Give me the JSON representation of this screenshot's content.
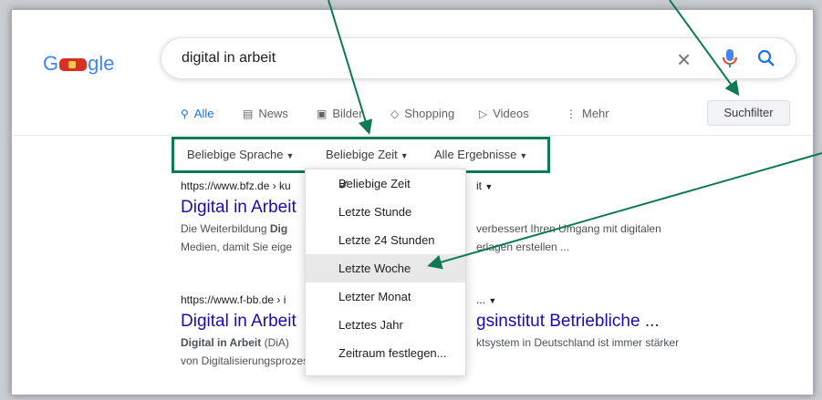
{
  "logo": {
    "text_left": "G",
    "text_right": "gle"
  },
  "search": {
    "query": "digital in arbeit",
    "clear_icon": "close-icon",
    "mic_icon": "microphone-icon",
    "search_icon": "search-icon"
  },
  "tabs": [
    {
      "label": "Alle",
      "icon": "search-icon"
    },
    {
      "label": "News",
      "icon": "news-icon"
    },
    {
      "label": "Bilder",
      "icon": "image-icon"
    },
    {
      "label": "Shopping",
      "icon": "tag-icon"
    },
    {
      "label": "Videos",
      "icon": "video-icon"
    },
    {
      "label": "Mehr",
      "icon": "more-icon"
    }
  ],
  "filter_button": "Suchfilter",
  "filterbar": {
    "language": "Beliebige Sprache",
    "time": "Beliebige Zeit",
    "results": "Alle Ergebnisse"
  },
  "dropdown": {
    "items": [
      "Beliebige Zeit",
      "Letzte Stunde",
      "Letzte 24 Stunden",
      "Letzte Woche",
      "Letzter Monat",
      "Letztes Jahr",
      "Zeitraum festlegen..."
    ],
    "selected": "Beliebige Zeit",
    "highlighted": "Letzte Woche"
  },
  "results": [
    {
      "url_start": "https://www.bfz.de › ku",
      "url_end": "it",
      "title": "Digital in Arbeit",
      "snippet1_pre": "Die Weiterbildung ",
      "snippet1_bold": "Dig",
      "snippet1_post": "verbessert Ihren Umgang mit digitalen",
      "snippet2_pre": "Medien, damit Sie eige",
      "snippet2_post": "erlagen erstellen ..."
    },
    {
      "url_start": "https://www.f-bb.de › i",
      "url_end": "...",
      "title_start": "Digital in Arbeit",
      "title_end": "gsinstitut Betriebliche ...",
      "snippet1_bold": "Digital in Arbeit",
      "snippet1_mid": " (DiA)",
      "snippet1_post": "ktsystem in Deutschland ist immer stärker",
      "snippet2": "von Digitalisierungsprozessen geprägt."
    }
  ],
  "colors": {
    "annotation": "#0d7a55",
    "link": "#1a0dab",
    "accent": "#1a73e8"
  }
}
